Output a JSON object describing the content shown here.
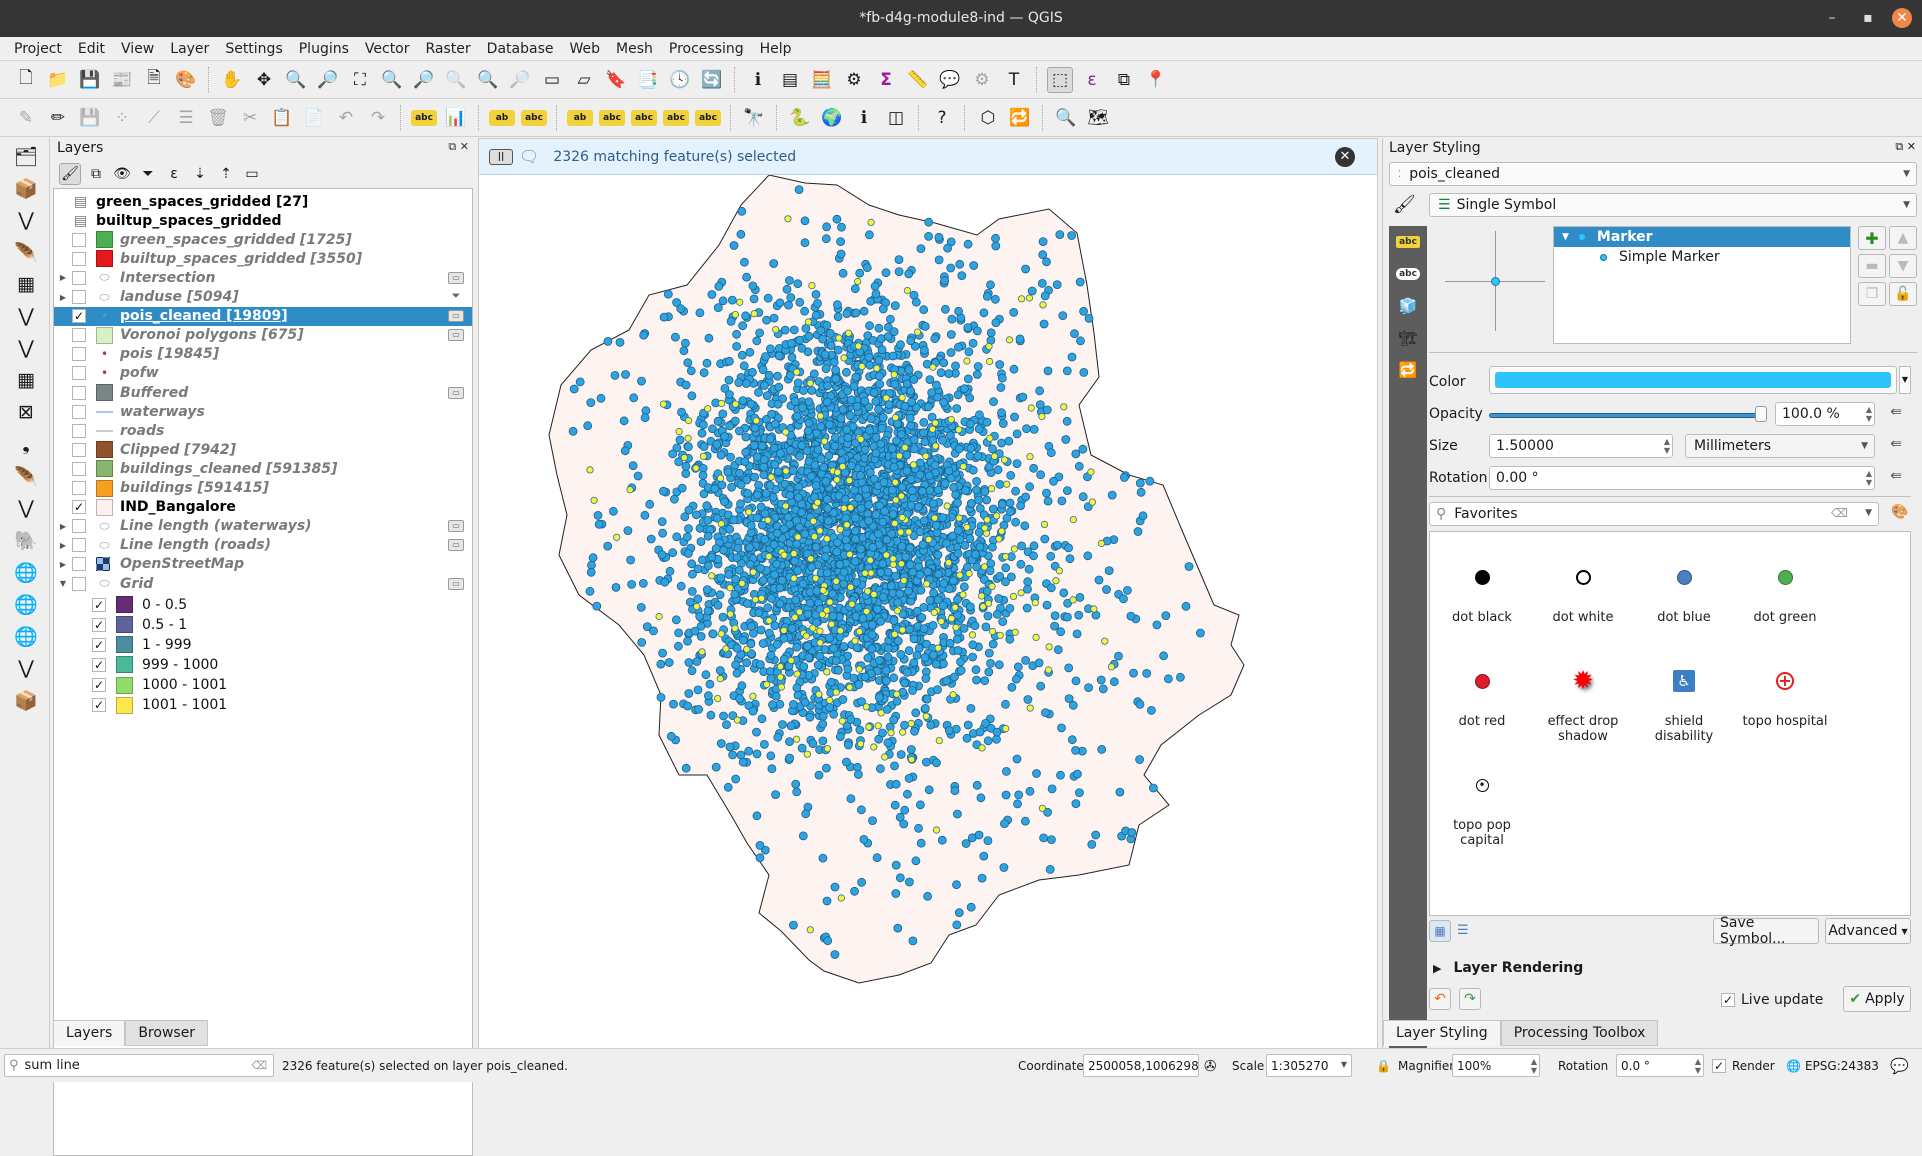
{
  "window": {
    "title": "*fb-d4g-module8-ind — QGIS",
    "minimize": "–",
    "maximize": "▪",
    "close": "✕"
  },
  "menu": [
    "Project",
    "Edit",
    "View",
    "Layer",
    "Settings",
    "Plugins",
    "Vector",
    "Raster",
    "Database",
    "Web",
    "Mesh",
    "Processing",
    "Help"
  ],
  "toolbar1": [
    {
      "icon": "new-project-icon",
      "glyph": "🗋"
    },
    {
      "icon": "open-project-icon",
      "glyph": "📁"
    },
    {
      "icon": "save-project-icon",
      "glyph": "💾"
    },
    {
      "icon": "new-print-layout-icon",
      "glyph": "📰"
    },
    {
      "icon": "layout-manager-icon",
      "glyph": "🗎"
    },
    {
      "icon": "style-manager-icon",
      "glyph": "🎨"
    },
    {
      "sep": true
    },
    {
      "icon": "pan-icon",
      "glyph": "✋"
    },
    {
      "icon": "pan-to-selection-icon",
      "glyph": "✥"
    },
    {
      "icon": "zoom-in-icon",
      "glyph": "🔍"
    },
    {
      "icon": "zoom-out-icon",
      "glyph": "🔎"
    },
    {
      "icon": "zoom-full-icon",
      "glyph": "⛶"
    },
    {
      "icon": "zoom-to-selection-icon",
      "glyph": "🔍"
    },
    {
      "icon": "zoom-to-layer-icon",
      "glyph": "🔎"
    },
    {
      "icon": "zoom-native-icon",
      "glyph": "🔍",
      "disabled": true
    },
    {
      "icon": "zoom-last-icon",
      "glyph": "🔍"
    },
    {
      "icon": "zoom-next-icon",
      "glyph": "🔎",
      "disabled": true
    },
    {
      "icon": "new-map-view-icon",
      "glyph": "▭"
    },
    {
      "icon": "new-3d-map-icon",
      "glyph": "▱"
    },
    {
      "icon": "new-bookmark-icon",
      "glyph": "🔖"
    },
    {
      "icon": "show-bookmarks-icon",
      "glyph": "📑"
    },
    {
      "icon": "temporal-controller-icon",
      "glyph": "🕓"
    },
    {
      "icon": "refresh-icon",
      "glyph": "🔄"
    },
    {
      "sep": true
    },
    {
      "icon": "identify-icon",
      "glyph": "ℹ"
    },
    {
      "icon": "attribute-table-icon",
      "glyph": "▤"
    },
    {
      "icon": "field-calculator-icon",
      "glyph": "🧮"
    },
    {
      "icon": "processing-toolbox-icon",
      "glyph": "⚙"
    },
    {
      "icon": "statistical-summary-icon",
      "glyph": "Σ"
    },
    {
      "icon": "measure-icon",
      "glyph": "📏"
    },
    {
      "icon": "map-tips-icon",
      "glyph": "💬"
    },
    {
      "icon": "run-action-icon",
      "glyph": "⚙",
      "disabled": true
    },
    {
      "icon": "text-annotation-icon",
      "glyph": "T"
    },
    {
      "sep": true
    },
    {
      "icon": "select-features-icon",
      "glyph": "⬚",
      "active": true
    },
    {
      "icon": "select-by-expression-icon",
      "glyph": "ε"
    },
    {
      "icon": "deselect-features-icon",
      "glyph": "⧉"
    },
    {
      "icon": "select-by-location-icon",
      "glyph": "📍"
    }
  ],
  "toolbar2": [
    {
      "icon": "digitize-icon",
      "glyph": "✎",
      "disabled": true
    },
    {
      "icon": "toggle-editing-icon",
      "glyph": "✏"
    },
    {
      "icon": "save-edits-icon",
      "glyph": "💾",
      "disabled": true
    },
    {
      "icon": "add-point-icon",
      "glyph": "⁘",
      "disabled": true
    },
    {
      "icon": "vertex-tool-icon",
      "glyph": "⟋",
      "disabled": true
    },
    {
      "icon": "modify-attributes-icon",
      "glyph": "☰",
      "disabled": true
    },
    {
      "icon": "delete-selected-icon",
      "glyph": "🗑",
      "disabled": true
    },
    {
      "icon": "cut-features-icon",
      "glyph": "✂",
      "disabled": true
    },
    {
      "icon": "copy-features-icon",
      "glyph": "📋"
    },
    {
      "icon": "paste-features-icon",
      "glyph": "📄",
      "disabled": true
    },
    {
      "icon": "undo-icon",
      "glyph": "↶",
      "disabled": true
    },
    {
      "icon": "redo-icon",
      "glyph": "↷",
      "disabled": true
    },
    {
      "sep": true
    },
    {
      "icon": "label-toolbar-icon",
      "glyph": "abc"
    },
    {
      "icon": "diagram-icon",
      "glyph": "📊"
    },
    {
      "sep": true
    },
    {
      "icon": "pin-labels-icon",
      "glyph": "ab"
    },
    {
      "icon": "highlight-labels-icon",
      "glyph": "abc"
    },
    {
      "sep": true
    },
    {
      "icon": "move-label-icon",
      "glyph": "ab"
    },
    {
      "icon": "show-hide-labels-icon",
      "glyph": "abc"
    },
    {
      "icon": "rotate-label-icon",
      "glyph": "abc"
    },
    {
      "icon": "change-label-icon",
      "glyph": "abc"
    },
    {
      "icon": "edit-label-icon",
      "glyph": "abc"
    },
    {
      "sep": true
    },
    {
      "icon": "geocoder-icon",
      "glyph": "🔭"
    },
    {
      "sep": true
    },
    {
      "icon": "python-console-icon",
      "glyph": "🐍"
    },
    {
      "icon": "globe-icon",
      "glyph": "🌍"
    },
    {
      "icon": "metasearch-icon",
      "glyph": "ℹ"
    },
    {
      "icon": "map-swipe-icon",
      "glyph": "◫"
    },
    {
      "sep": true
    },
    {
      "icon": "help-icon",
      "glyph": "?"
    },
    {
      "sep": true
    },
    {
      "icon": "topology-checker-icon",
      "glyph": "⬡"
    },
    {
      "icon": "refresh-table-icon",
      "glyph": "🔁"
    },
    {
      "sep": true
    },
    {
      "icon": "locator-search-icon",
      "glyph": "🔍"
    },
    {
      "icon": "georeferencer-icon",
      "glyph": "🗺"
    }
  ],
  "lefttools": [
    {
      "icon": "data-source-manager-icon",
      "glyph": "🗂"
    },
    {
      "icon": "new-geopackage-icon",
      "glyph": "📦"
    },
    {
      "icon": "new-shapefile-icon",
      "glyph": "⋁"
    },
    {
      "icon": "new-temporary-layer-icon",
      "glyph": "🪶"
    },
    {
      "icon": "new-virtual-layer-icon",
      "glyph": "▦"
    },
    {
      "icon": "new-spatialite-icon",
      "glyph": "⋁"
    },
    {
      "icon": "add-vector-icon",
      "glyph": "⋁"
    },
    {
      "icon": "add-raster-icon",
      "glyph": "▦"
    },
    {
      "icon": "add-mesh-icon",
      "glyph": "⊠"
    },
    {
      "icon": "add-delimited-text-icon",
      "glyph": "❟"
    },
    {
      "icon": "add-virtual-layer-icon",
      "glyph": "🪶"
    },
    {
      "icon": "add-spatialite-icon",
      "glyph": "⋁"
    },
    {
      "icon": "add-postgis-icon",
      "glyph": "🐘"
    },
    {
      "icon": "add-wms-icon",
      "glyph": "🌐"
    },
    {
      "icon": "add-wfs-icon",
      "glyph": "🌐"
    },
    {
      "icon": "add-wcs-icon",
      "glyph": "🌐"
    },
    {
      "icon": "add-xyz-icon",
      "glyph": "⋁"
    },
    {
      "icon": "add-vector-tile-icon",
      "glyph": "📦"
    }
  ],
  "layers_panel": {
    "title": "Layers",
    "tabs": [
      "Layers",
      "Browser"
    ],
    "items": [
      {
        "label": "green_spaces_gridded [27]",
        "type": "table",
        "style": "on"
      },
      {
        "label": "builtup_spaces_gridded",
        "type": "table",
        "style": "on"
      },
      {
        "label": "green_spaces_gridded [1725]",
        "swatch": "#4caf50",
        "checked": false,
        "style": "off"
      },
      {
        "label": "builtup_spaces_gridded [3550]",
        "swatch": "#e31a1c",
        "checked": false,
        "style": "off"
      },
      {
        "label": "Intersection",
        "type": "group",
        "checked": false,
        "style": "off",
        "expand": "collapsed",
        "indicator": true
      },
      {
        "label": "landuse [5094]",
        "type": "group",
        "checked": false,
        "style": "off",
        "expand": "collapsed",
        "filter": true
      },
      {
        "label": "pois_cleaned [19809]",
        "type": "point",
        "pointcolor": "#3aa0e0",
        "checked": true,
        "style": "sel",
        "indicator": true
      },
      {
        "label": "Voronoi polygons [675]",
        "swatch": "#d9f0c4",
        "checked": false,
        "style": "off",
        "indicator": true
      },
      {
        "label": "pois [19845]",
        "type": "point",
        "pointcolor": "#8b4a3a",
        "checked": false,
        "style": "off"
      },
      {
        "label": "pofw",
        "type": "point",
        "pointcolor": "#8b4a3a",
        "checked": false,
        "style": "off"
      },
      {
        "label": "Buffered",
        "swatch": "#788687",
        "checked": false,
        "style": "off",
        "indicator": true
      },
      {
        "label": "waterways",
        "type": "line",
        "linecolor": "#a6c8ef",
        "checked": false,
        "style": "off"
      },
      {
        "label": "roads",
        "type": "line",
        "linecolor": "#cccccc",
        "checked": false,
        "style": "off"
      },
      {
        "label": "Clipped [7942]",
        "swatch": "#93522e",
        "checked": false,
        "style": "off"
      },
      {
        "label": "buildings_cleaned [591385]",
        "swatch": "#86b56e",
        "checked": false,
        "style": "off"
      },
      {
        "label": "buildings [591415]",
        "swatch": "#f5a11f",
        "checked": false,
        "style": "off"
      },
      {
        "label": "IND_Bangalore",
        "swatch": "#fdf1ee",
        "checked": true,
        "style": "on"
      },
      {
        "label": "Line length (waterways)",
        "type": "group",
        "checked": false,
        "style": "off",
        "expand": "collapsed",
        "indicator": true
      },
      {
        "label": "Line length (roads)",
        "type": "group",
        "checked": false,
        "style": "off",
        "expand": "collapsed",
        "indicator": true
      },
      {
        "label": "OpenStreetMap",
        "type": "raster",
        "checked": false,
        "style": "off",
        "expand": "collapsed"
      },
      {
        "label": "Grid",
        "type": "group",
        "checked": false,
        "style": "off",
        "expand": "expanded",
        "indicator": true
      }
    ],
    "grid_legend": [
      {
        "label": "0 - 0.5",
        "color": "#662d77"
      },
      {
        "label": "0.5 - 1",
        "color": "#5f629b"
      },
      {
        "label": "1 - 999",
        "color": "#4a8ea0"
      },
      {
        "label": "999 - 1000",
        "color": "#49b99a"
      },
      {
        "label": "1000 - 1001",
        "color": "#92dc6c"
      },
      {
        "label": "1001 - 1001",
        "color": "#fde74c"
      }
    ]
  },
  "map": {
    "message": "2326 matching feature(s) selected",
    "boundary_fill": "#fdf3f0",
    "point_color": "#2ea3df",
    "selected_color": "#f5f53c"
  },
  "styling_panel": {
    "title": "Layer Styling",
    "layer": "pois_cleaned",
    "renderer": "Single Symbol",
    "symbol_tree": {
      "root": "Marker",
      "child": "Simple Marker"
    },
    "color_label": "Color",
    "color_value": "#2ec4fa",
    "opacity_label": "Opacity",
    "opacity_value": "100.0 %",
    "opacity_fraction": 1.0,
    "size_label": "Size",
    "size_value": "1.50000",
    "size_unit": "Millimeters",
    "rotation_label": "Rotation",
    "rotation_value": "0.00 °",
    "library_filter": "Favorites",
    "favorites": [
      {
        "label": "dot  black",
        "kind": "dot",
        "color": "#000000"
      },
      {
        "label": "dot  white",
        "kind": "ring",
        "color": "#ffffff"
      },
      {
        "label": "dot blue",
        "kind": "dot",
        "color": "#4a7fc0"
      },
      {
        "label": "dot green",
        "kind": "dot",
        "color": "#4caf50"
      },
      {
        "label": "dot red",
        "kind": "dot",
        "color": "#dd1c2c"
      },
      {
        "label": "effect drop shadow",
        "kind": "star",
        "color": "#ff0000"
      },
      {
        "label": "shield disability",
        "kind": "disability",
        "color": "#3e7ec6"
      },
      {
        "label": "topo hospital",
        "kind": "hospital",
        "color": "#e02020"
      },
      {
        "label": "topo pop capital",
        "kind": "capital",
        "color": "#000000"
      }
    ],
    "save_symbol": "Save Symbol...",
    "advanced": "Advanced",
    "layer_rendering": "Layer Rendering",
    "live_update": "Live update",
    "live_update_checked": true,
    "apply": "Apply",
    "tabs": [
      "Layer Styling",
      "Processing Toolbox"
    ]
  },
  "statusbar": {
    "search_value": "sum line",
    "message": "2326 feature(s) selected on layer pois_cleaned.",
    "coordinate_label": "Coordinate",
    "coordinate_value": "2500058,1006298",
    "scale_label": "Scale",
    "scale_value": "1:305270",
    "magnifier_label": "Magnifier",
    "magnifier_value": "100%",
    "rotation_label": "Rotation",
    "rotation_value": "0.0 °",
    "render_label": "Render",
    "render_checked": true,
    "crs": "EPSG:24383"
  }
}
